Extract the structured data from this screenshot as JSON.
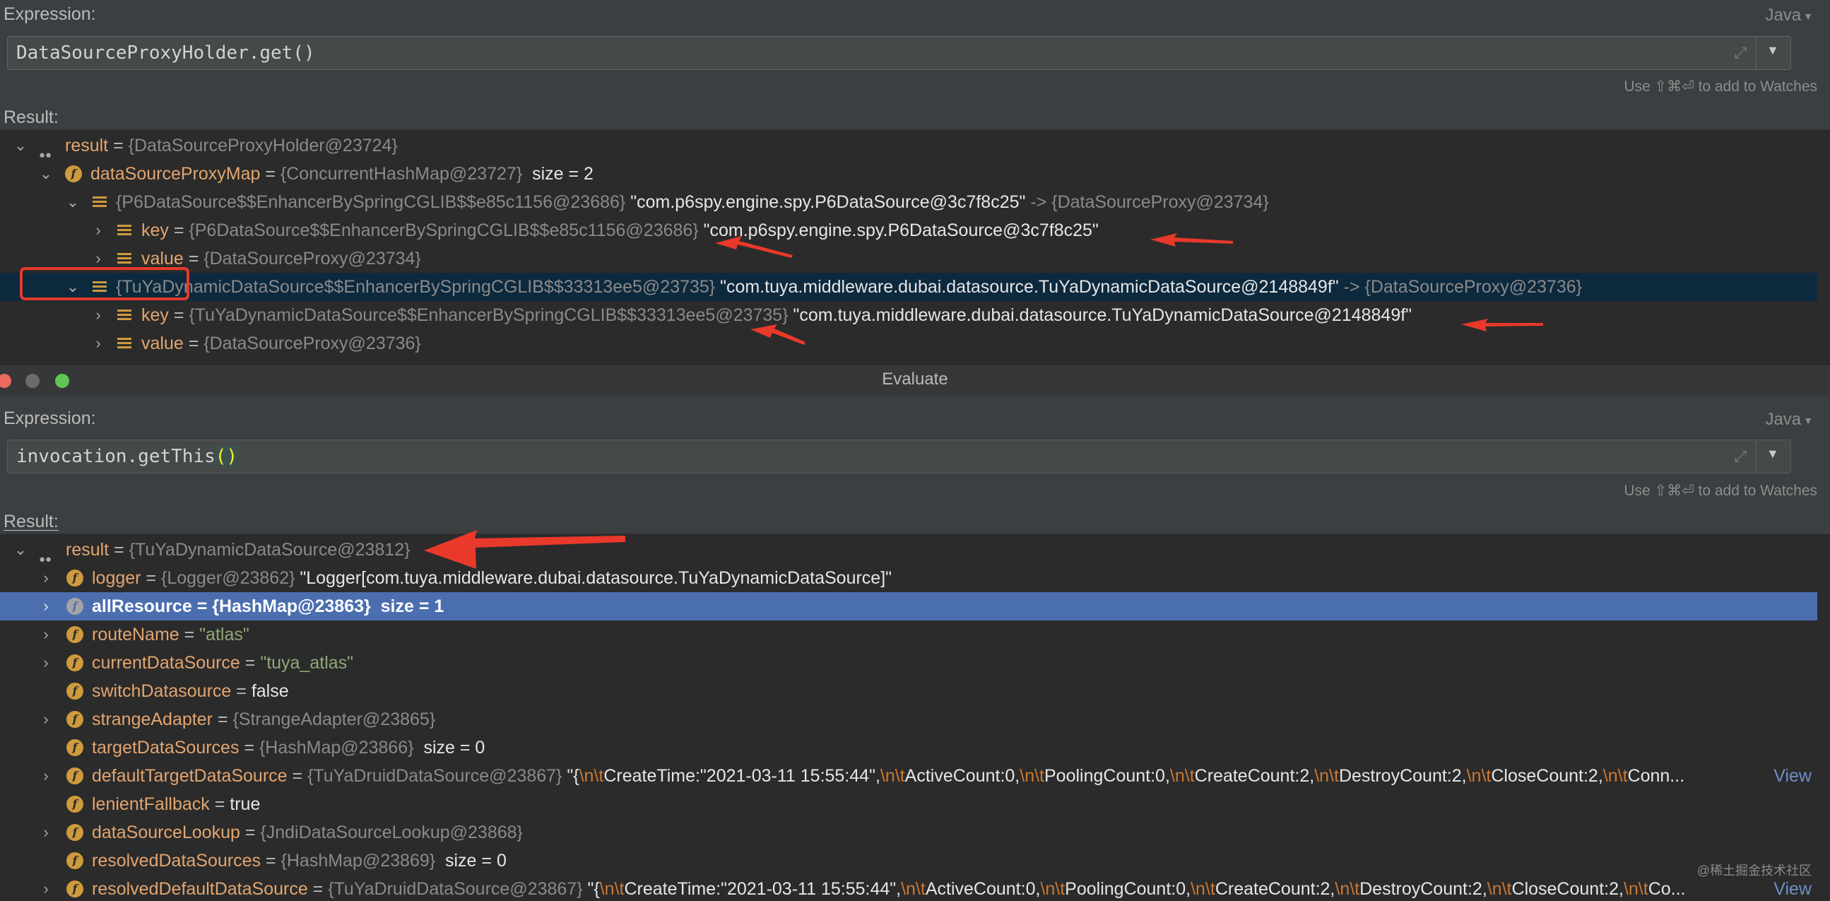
{
  "top": {
    "expression_label": "Expression:",
    "lang": "Java",
    "expression": "DataSourceProxyHolder.get()",
    "hint": "Use ⇧⌘⏎ to add to Watches",
    "result_label": "Result:",
    "rows": [
      {
        "name": "result",
        "eq": " = ",
        "gray": "{DataSourceProxyHolder@23724}"
      },
      {
        "name": "dataSourceProxyMap",
        "eq": " = ",
        "gray": "{ConcurrentHashMap@23727}",
        "extra": "  size = 2"
      },
      {
        "gray": "{P6DataSource$$EnhancerBySpringCGLIB$$e85c1156@23686}",
        "str": " \"com.p6spy.engine.spy.P6DataSource@3c7f8c25\"",
        "tail": " -> {DataSourceProxy@23734}"
      },
      {
        "name": "key",
        "eq": " = ",
        "gray": "{P6DataSource$$EnhancerBySpringCGLIB$$e85c1156@23686}",
        "str": " \"com.p6spy.engine.spy.P6DataSource@3c7f8c25\""
      },
      {
        "name": "value",
        "eq": " = ",
        "gray": "{DataSourceProxy@23734}"
      },
      {
        "gray": "{TuYaDynamicDataSource$$EnhancerBySpringCGLIB$$33313ee5@23735}",
        "str": " \"com.tuya.middleware.dubai.datasource.TuYaDynamicDataSource@2148849f\"",
        "tail": " -> {DataSourceProxy@23736}"
      },
      {
        "name": "key",
        "eq": " = ",
        "gray": "{TuYaDynamicDataSource$$EnhancerBySpringCGLIB$$33313ee5@23735}",
        "str": " \"com.tuya.middleware.dubai.datasource.TuYaDynamicDataSource@2148849f\""
      },
      {
        "name": "value",
        "eq": " = ",
        "gray": "{DataSourceProxy@23736}"
      }
    ]
  },
  "window_title": "Evaluate",
  "bottom": {
    "expression_label": "Expression:",
    "lang": "Java",
    "expression_pre": "invocation.getThis",
    "expression_paren": "()",
    "hint": "Use ⇧⌘⏎ to add to Watches",
    "result_label": "Result:",
    "rows": [
      {
        "name": "result",
        "eq": " = ",
        "gray": "{TuYaDynamicDataSource@23812}"
      },
      {
        "name": "logger",
        "eq": " = ",
        "gray": "{Logger@23862}",
        "str": " \"Logger[com.tuya.middleware.dubai.datasource.TuYaDynamicDataSource]\""
      },
      {
        "name": "allResource",
        "eq": " = ",
        "gray": "{HashMap@23863}",
        "extra": "  size = 1"
      },
      {
        "name": "routeName",
        "eq": " = ",
        "strg": "\"atlas\""
      },
      {
        "name": "currentDataSource",
        "eq": " = ",
        "strg": "\"tuya_atlas\""
      },
      {
        "name": "switchDatasource",
        "eq": " = ",
        "extra": "false"
      },
      {
        "name": "strangeAdapter",
        "eq": " = ",
        "gray": "{StrangeAdapter@23865}"
      },
      {
        "name": "targetDataSources",
        "eq": " = ",
        "gray": "{HashMap@23866}",
        "extra": "  size = 0"
      },
      {
        "name": "defaultTargetDataSource",
        "eq": " = ",
        "gray": "{TuYaDruidDataSource@23867}",
        "s": [
          " \"{",
          "\\n\\t",
          "CreateTime:\"2021-03-11 15:55:44\",",
          "\\n\\t",
          "ActiveCount:0,",
          "\\n\\t",
          "PoolingCount:0,",
          "\\n\\t",
          "CreateCount:2,",
          "\\n\\t",
          "DestroyCount:2,",
          "\\n\\t",
          "CloseCount:2,",
          "\\n\\t",
          "Conn..."
        ],
        "view": " View"
      },
      {
        "name": "lenientFallback",
        "eq": " = ",
        "extra": "true"
      },
      {
        "name": "dataSourceLookup",
        "eq": " = ",
        "gray": "{JndiDataSourceLookup@23868}"
      },
      {
        "name": "resolvedDataSources",
        "eq": " = ",
        "gray": "{HashMap@23869}",
        "extra": "  size = 0"
      },
      {
        "name": "resolvedDefaultDataSource",
        "eq": " = ",
        "gray": "{TuYaDruidDataSource@23867}",
        "s": [
          " \"{",
          "\\n\\t",
          "CreateTime:\"2021-03-11 15:55:44\",",
          "\\n\\t",
          "ActiveCount:0,",
          "\\n\\t",
          "PoolingCount:0,",
          "\\n\\t",
          "CreateCount:2,",
          "\\n\\t",
          "DestroyCount:2,",
          "\\n\\t",
          "CloseCount:2,",
          "\\n\\t",
          "Co..."
        ],
        "view": " View"
      }
    ]
  },
  "watermark": "@稀土掘金技术社区",
  "colors": {
    "annotation": "#e8392b",
    "selection_blue": "#4b6eaf",
    "selection_dark": "#0d293e"
  }
}
